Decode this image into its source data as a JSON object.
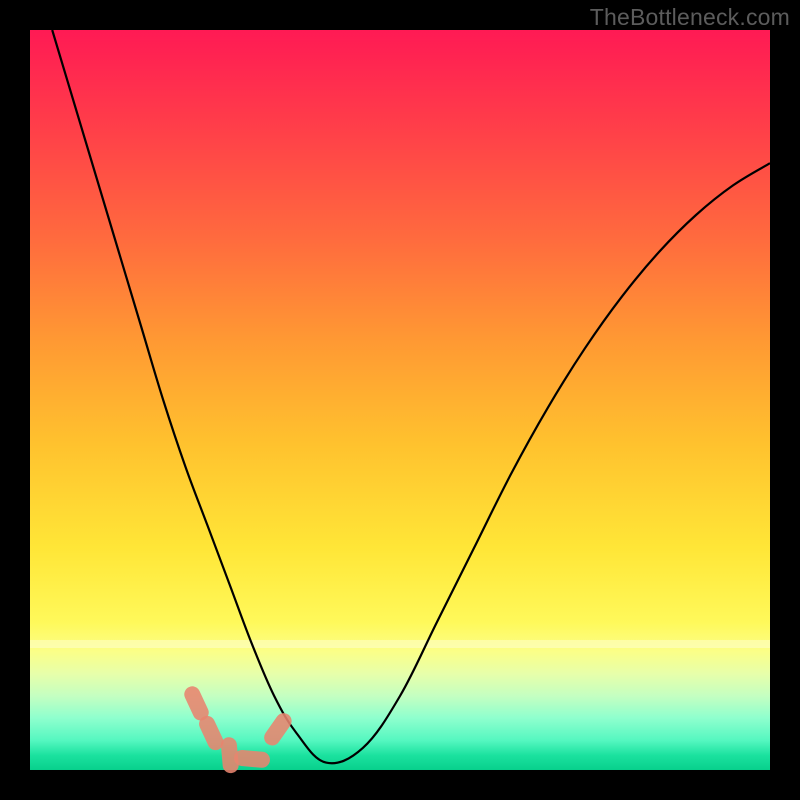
{
  "watermark": "TheBottleneck.com",
  "chart_data": {
    "type": "line",
    "title": "",
    "xlabel": "",
    "ylabel": "",
    "xlim": [
      0,
      100
    ],
    "ylim": [
      0,
      100
    ],
    "grid": false,
    "series": [
      {
        "name": "bottleneck-curve",
        "x": [
          3,
          6,
          9,
          12,
          15,
          18,
          21,
          24,
          27,
          30,
          33,
          36,
          40,
          45,
          50,
          55,
          60,
          65,
          70,
          75,
          80,
          85,
          90,
          95,
          100
        ],
        "y": [
          100,
          90,
          80,
          70,
          60,
          50,
          41,
          33,
          25,
          17,
          10,
          5,
          1,
          3,
          10,
          20,
          30,
          40,
          49,
          57,
          64,
          70,
          75,
          79,
          82
        ]
      }
    ],
    "markers": [
      {
        "x": 22.5,
        "y": 9
      },
      {
        "x": 24.5,
        "y": 5
      },
      {
        "x": 27.0,
        "y": 2
      },
      {
        "x": 30.0,
        "y": 1.5
      },
      {
        "x": 33.5,
        "y": 5.5
      }
    ],
    "background": "rainbow-vertical-gradient",
    "colors": {
      "curve": "#000000",
      "marker": "#e9856f"
    }
  }
}
